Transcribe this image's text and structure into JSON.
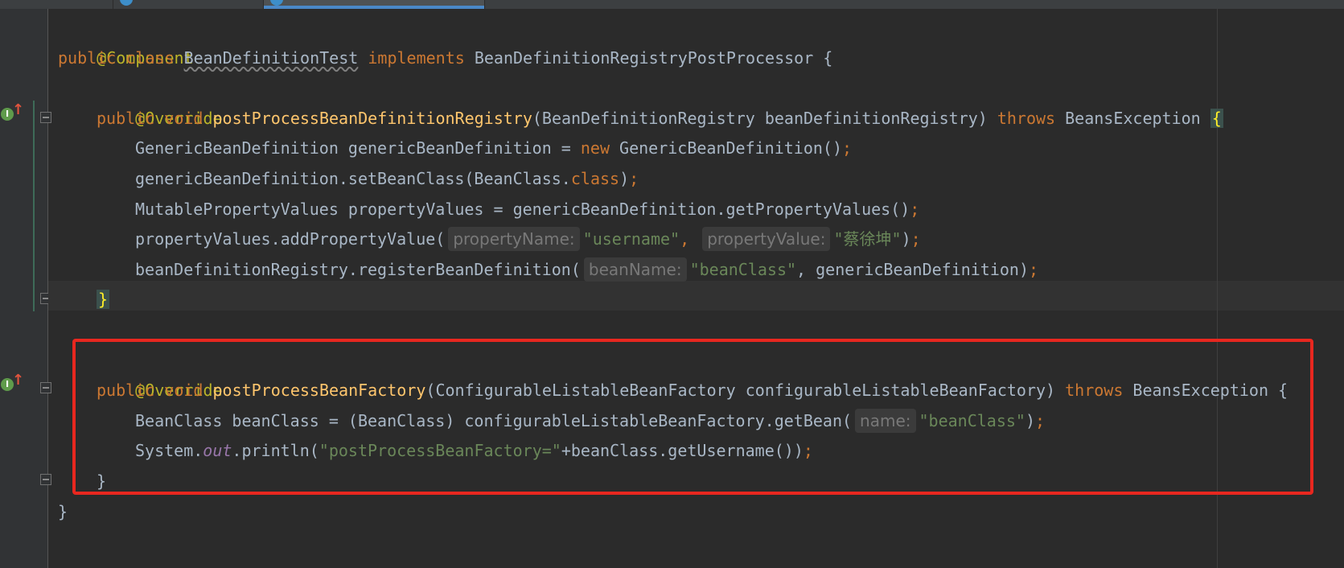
{
  "editor": {
    "tabs": [
      {
        "label": ""
      },
      {
        "label": ""
      },
      {
        "label": "",
        "active": true
      }
    ],
    "hints": {
      "property_name": "propertyName:",
      "property_value": "propertyValue:",
      "bean_name": "beanName:",
      "name": "name:"
    },
    "code": {
      "l1_annotation": "@Component",
      "l2_public": "public",
      "l2_class": "class",
      "l2_name": "BeanDefinitionTest",
      "l2_implements": "implements",
      "l2_iface": "BeanDefinitionRegistryPostProcessor {",
      "override": "@Override",
      "public_void": "public void ",
      "m1_name": "postProcessBeanDefinitionRegistry",
      "m1_params": "(BeanDefinitionRegistry beanDefinitionRegistry) ",
      "throws": "throws",
      "beans_exception": " BeansException ",
      "open_brace": "{",
      "l5_a": "GenericBeanDefinition genericBeanDefinition = ",
      "new": "new",
      "l5_b": " GenericBeanDefinition()",
      "semicolon": ";",
      "l6_a": "genericBeanDefinition.setBeanClass(BeanClass.",
      "class_kw": "class",
      "l6_b": ")",
      "l7_a": "MutablePropertyValues propertyValues = genericBeanDefinition.getPropertyValues()",
      "l8_a": "propertyValues.addPropertyValue(",
      "l8_str1": "\"username\"",
      "comma": ",",
      "l8_str2": "\"蔡徐坤\"",
      "l8_b": ")",
      "l9_a": "beanDefinitionRegistry.registerBeanDefinition(",
      "l9_str": "\"beanClass\"",
      "l9_b": ", genericBeanDefinition)",
      "close_brace": "}",
      "m2_name": "postProcessBeanFactory",
      "m2_params": "(ConfigurableListableBeanFactory configurableListableBeanFactory) ",
      "m2_tail": " BeansException {",
      "l14_a": "BeanClass beanClass = (BeanClass) configurableListableBeanFactory.getBean(",
      "l14_str": "\"beanClass\"",
      "l14_b": ")",
      "l15_a": "System.",
      "l15_out": "out",
      "l15_b": ".println(",
      "l15_str": "\"postProcessBeanFactory=\"",
      "l15_c": "+beanClass.getUsername())"
    }
  },
  "colors": {
    "background": "#2b2b2b",
    "keyword": "#cc7832",
    "annotation": "#bbb529",
    "method": "#ffc66d",
    "string": "#6a8759",
    "highlight_box": "#e8271f"
  }
}
